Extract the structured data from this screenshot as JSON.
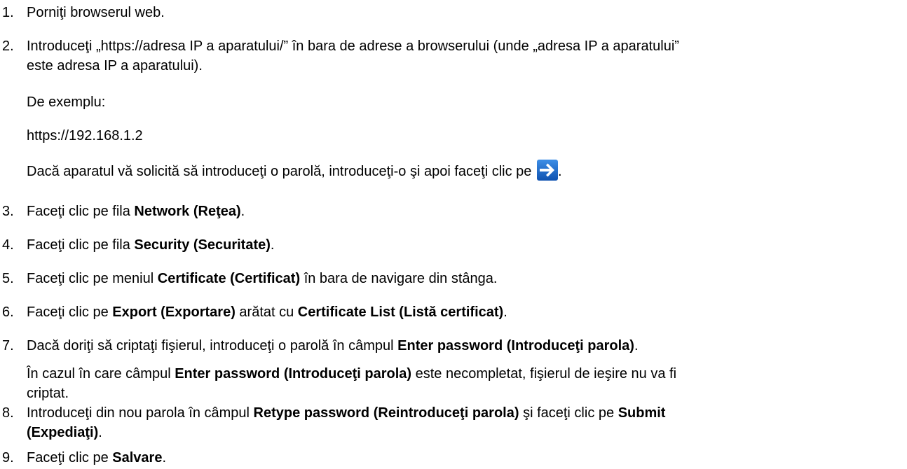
{
  "steps": [
    {
      "num": "1.",
      "text": "Porniţi browserul web."
    },
    {
      "num": "2.",
      "line1": "Introduceţi „https://adresa IP a aparatului/” în bara de adrese a browserului (unde „adresa IP a aparatului”",
      "line2": "este adresa IP a aparatului).",
      "example_label": "De exemplu:",
      "example_url": "https://192.168.1.2",
      "password_note": "Dacă aparatul vă solicită să introduceţi o parolă, introduceţi-o şi apoi faceţi clic pe",
      "password_note_end": "."
    },
    {
      "num": "3.",
      "pre": "Faceţi clic pe fila ",
      "bold": "Network (Reţea)",
      "post": "."
    },
    {
      "num": "4.",
      "pre": "Faceţi clic pe fila ",
      "bold": "Security (Securitate)",
      "post": "."
    },
    {
      "num": "5.",
      "pre": "Faceţi clic pe meniul ",
      "bold": "Certificate (Certificat)",
      "post": " în bara de navigare din stânga."
    },
    {
      "num": "6.",
      "pre": "Faceţi clic pe ",
      "bold": "Export (Exportare)",
      "mid": " arătat cu ",
      "bold2": "Certificate List (Listă certificat)",
      "post": "."
    },
    {
      "num": "7.",
      "pre": "Dacă doriţi să criptaţi fişierul, introduceţi o parolă în câmpul ",
      "bold": "Enter password (Introduceţi parola)",
      "post": ".",
      "note_pre": "În cazul în care câmpul ",
      "note_bold": "Enter password (Introduceţi parola)",
      "note_post": " este necompletat, fişierul de ieşire nu va fi",
      "note_line2": "criptat."
    },
    {
      "num": "8.",
      "pre": "Introduceţi din nou parola în câmpul ",
      "bold": "Retype password (Reintroduceţi parola)",
      "mid": " şi faceţi clic pe ",
      "bold2": "Submit",
      "line2_bold": "(Expediaţi)",
      "line2_post": "."
    },
    {
      "num": "9.",
      "pre": "Faceţi clic pe ",
      "bold": "Salvare",
      "post": "."
    }
  ],
  "icon": {
    "name": "arrow-right-icon",
    "bg_color": "#1a66c8",
    "arrow_color": "#ffffff"
  }
}
